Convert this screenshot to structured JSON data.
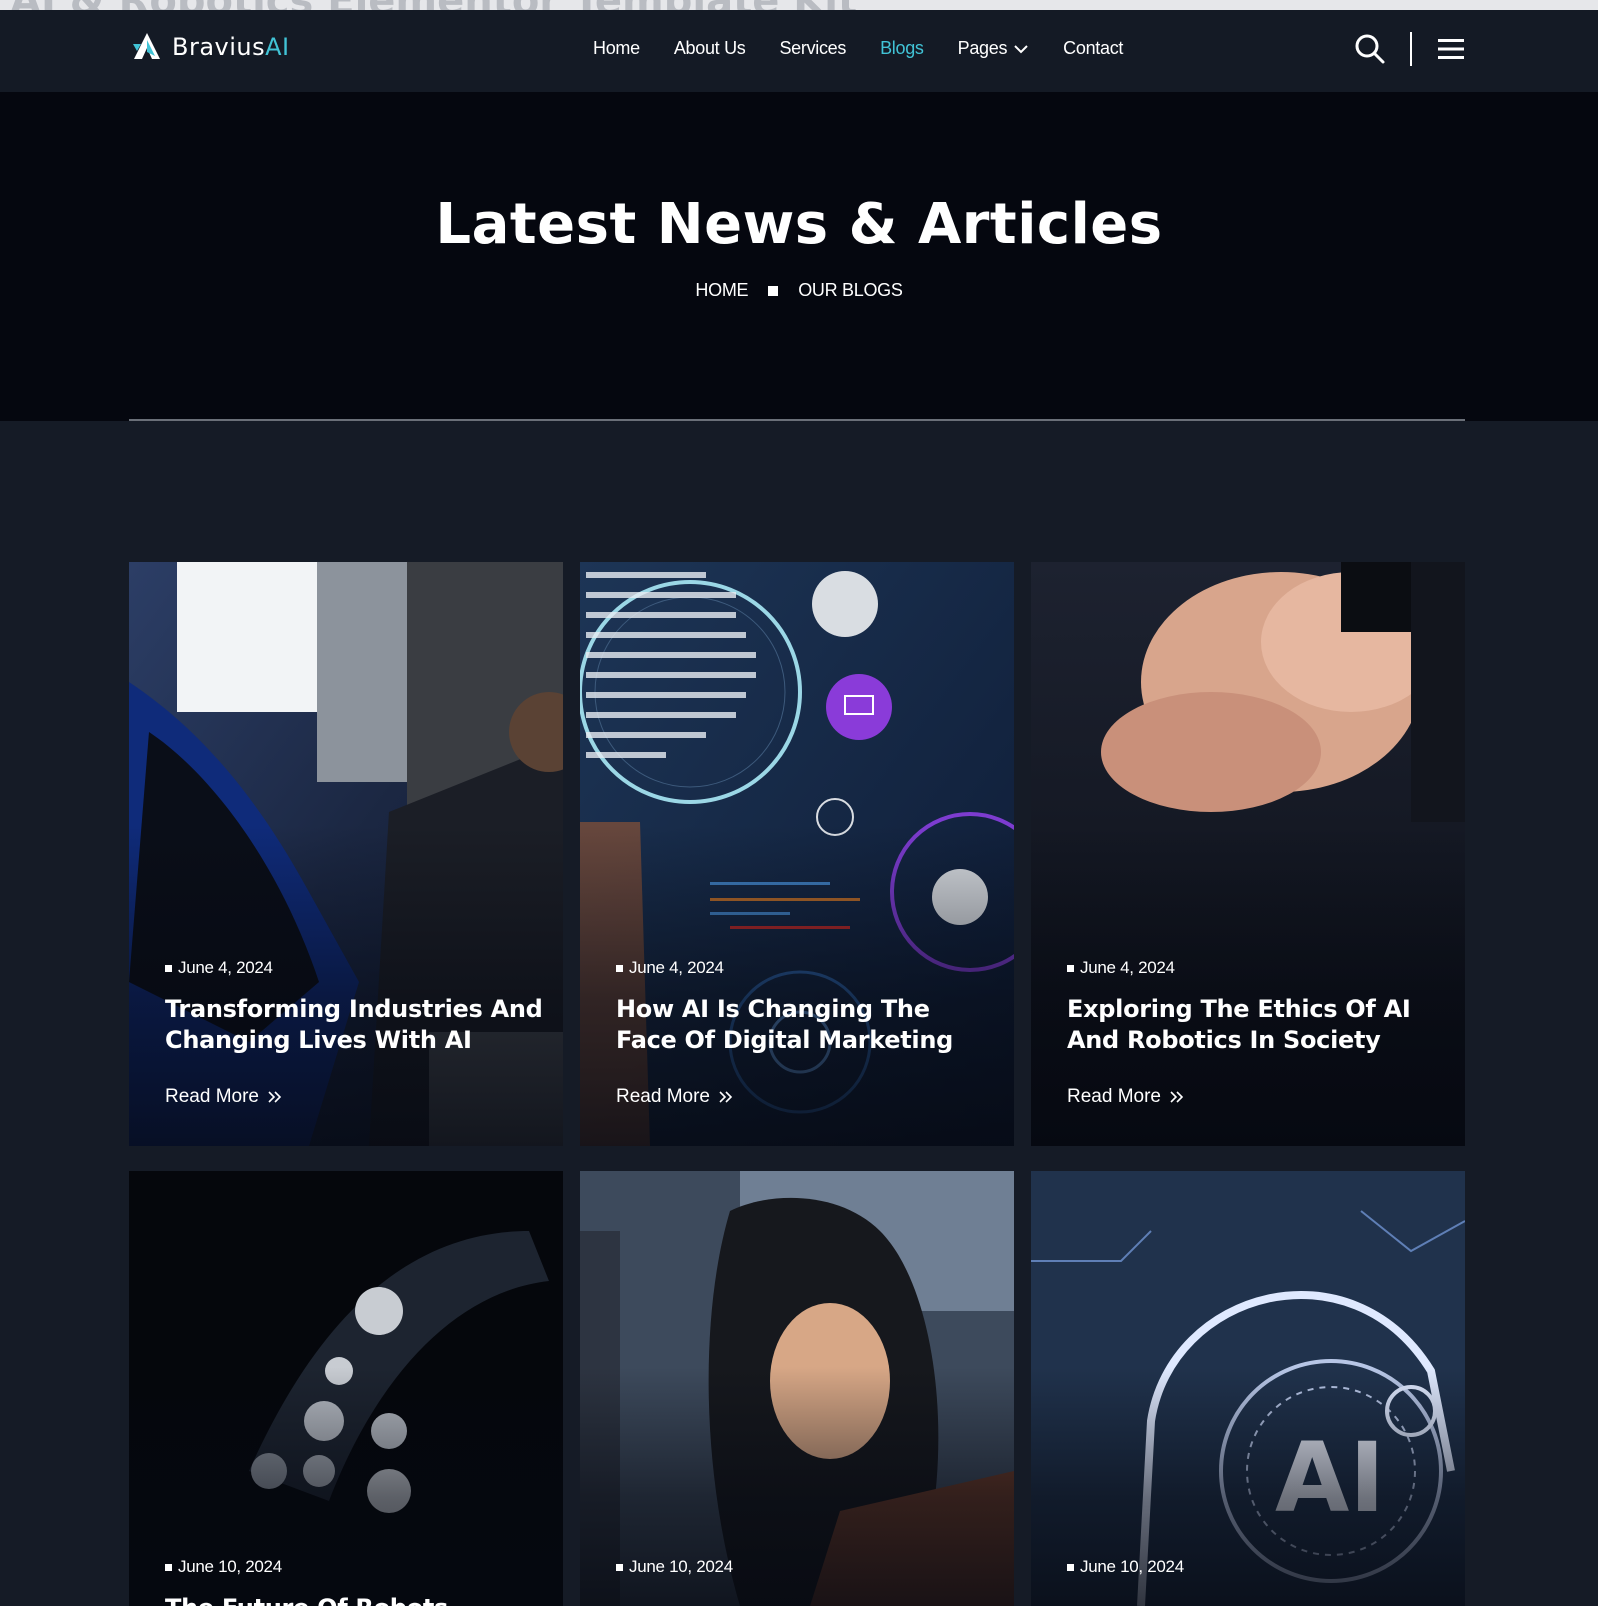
{
  "ghost_title": "AI & Robotics Elementor Template Kit",
  "brand": {
    "name_main": "Bravius",
    "name_accent": "AI"
  },
  "nav": {
    "items": [
      {
        "label": "Home"
      },
      {
        "label": "About Us"
      },
      {
        "label": "Services"
      },
      {
        "label": "Blogs",
        "active": true
      },
      {
        "label": "Pages"
      },
      {
        "label": "Contact"
      }
    ]
  },
  "hero": {
    "title": "Latest News & Articles",
    "breadcrumb": {
      "home": "HOME",
      "current": "OUR BLOGS"
    }
  },
  "posts": [
    {
      "date": "June 4, 2024",
      "title": "Transforming Industries And Changing Lives With AI",
      "read_more": "Read More"
    },
    {
      "date": "June 4, 2024",
      "title": "How AI Is Changing The Face Of Digital Marketing",
      "read_more": "Read More"
    },
    {
      "date": "June 4, 2024",
      "title": "Exploring The Ethics Of AI And Robotics In Society",
      "read_more": "Read More"
    },
    {
      "date": "June 10, 2024",
      "title": "The Future Of Robots –"
    },
    {
      "date": "June 10, 2024"
    },
    {
      "date": "June 10, 2024"
    }
  ],
  "colors": {
    "accent": "#41c3d6",
    "header_bg": "#141a25",
    "hero_bg": "#05070f",
    "page_bg": "#151b26"
  }
}
